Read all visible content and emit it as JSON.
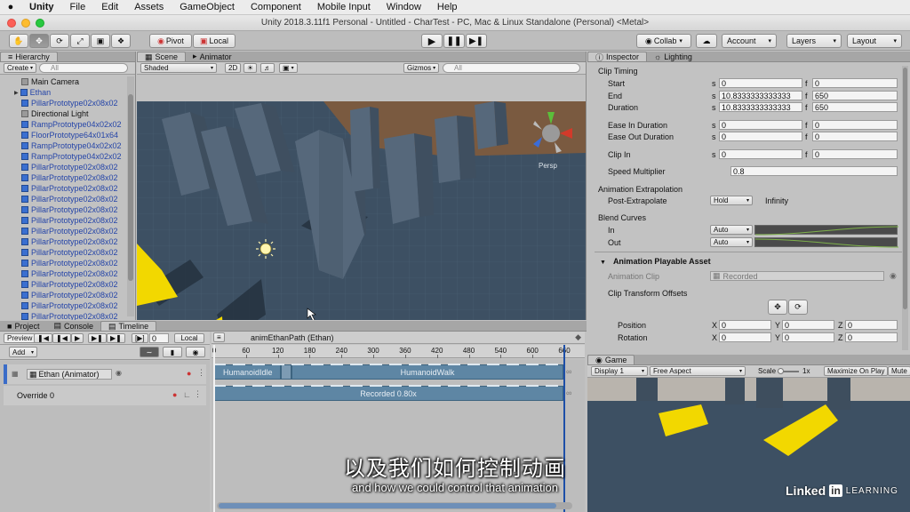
{
  "menubar": {
    "apple": "",
    "items": [
      "Unity",
      "File",
      "Edit",
      "Assets",
      "GameObject",
      "Component",
      "Mobile Input",
      "Window",
      "Help"
    ]
  },
  "window_title": "Unity 2018.3.11f1 Personal - Untitled - CharTest - PC, Mac & Linux Standalone (Personal) <Metal>",
  "toolbar": {
    "pivot": "Pivot",
    "local": "Local",
    "collab": "Collab",
    "account": "Account",
    "layers": "Layers",
    "layout": "Layout"
  },
  "hierarchy": {
    "tab": "Hierarchy",
    "create": "Create",
    "search_placeholder": "All",
    "items": [
      {
        "name": "Main Camera",
        "blue": false
      },
      {
        "name": "Ethan",
        "blue": true
      },
      {
        "name": "PillarPrototype02x08x02",
        "blue": true
      },
      {
        "name": "Directional Light",
        "blue": false
      },
      {
        "name": "RampPrototype04x02x02",
        "blue": true
      },
      {
        "name": "FloorPrototype64x01x64",
        "blue": true
      },
      {
        "name": "RampPrototype04x02x02",
        "blue": true
      },
      {
        "name": "RampPrototype04x02x02",
        "blue": true
      },
      {
        "name": "PillarPrototype02x08x02",
        "blue": true
      },
      {
        "name": "PillarPrototype02x08x02",
        "blue": true
      },
      {
        "name": "PillarPrototype02x08x02",
        "blue": true
      },
      {
        "name": "PillarPrototype02x08x02",
        "blue": true
      },
      {
        "name": "PillarPrototype02x08x02",
        "blue": true
      },
      {
        "name": "PillarPrototype02x08x02",
        "blue": true
      },
      {
        "name": "PillarPrototype02x08x02",
        "blue": true
      },
      {
        "name": "PillarPrototype02x08x02",
        "blue": true
      },
      {
        "name": "PillarPrototype02x08x02",
        "blue": true
      },
      {
        "name": "PillarPrototype02x08x02",
        "blue": true
      },
      {
        "name": "PillarPrototype02x08x02",
        "blue": true
      },
      {
        "name": "PillarPrototype02x08x02",
        "blue": true
      },
      {
        "name": "PillarPrototype02x08x02",
        "blue": true
      },
      {
        "name": "PillarPrototype02x08x02",
        "blue": true
      },
      {
        "name": "PillarPrototype02x08x02",
        "blue": true
      },
      {
        "name": "PillarPrototype02x08x02",
        "blue": true
      }
    ]
  },
  "scene": {
    "tabs": [
      "Scene",
      "Animator"
    ],
    "shading": "Shaded",
    "mode_2d": "2D",
    "gizmos": "Gizmos",
    "search_placeholder": "All",
    "persp": "Persp"
  },
  "inspector": {
    "tabs": [
      "Inspector",
      "Lighting"
    ],
    "clip_timing": "Clip Timing",
    "start_label": "Start",
    "start_s": "0",
    "start_f": "0",
    "end_label": "End",
    "end_s": "10.8333333333333",
    "end_f": "650",
    "duration_label": "Duration",
    "duration_s": "10.8333333333333",
    "duration_f": "650",
    "ease_in_label": "Ease In Duration",
    "ease_in_s": "0",
    "ease_in_f": "0",
    "ease_out_label": "Ease Out Duration",
    "ease_out_s": "0",
    "ease_out_f": "0",
    "clip_in_label": "Clip In",
    "clip_in_s": "0",
    "clip_in_f": "0",
    "s": "s",
    "f": "f",
    "speed_label": "Speed Multiplier",
    "speed_value": "0.8",
    "extrapolation_header": "Animation Extrapolation",
    "post_label": "Post-Extrapolate",
    "post_value": "Hold",
    "post_infinity": "Infinity",
    "blend_header": "Blend Curves",
    "in_label": "In",
    "in_value": "Auto",
    "out_label": "Out",
    "out_value": "Auto",
    "playable_header": "Animation Playable Asset",
    "anim_clip_label": "Animation Clip",
    "anim_clip_value": "Recorded",
    "offsets_label": "Clip Transform Offsets",
    "position_label": "Position",
    "rotation_label": "Rotation",
    "x": "X",
    "y": "Y",
    "z": "Z",
    "pos_x": "0",
    "pos_y": "0",
    "pos_z": "0",
    "rot_x": "0",
    "rot_y": "0",
    "rot_z": "0"
  },
  "bottom_tabs": [
    "Project",
    "Console",
    "Timeline"
  ],
  "timeline": {
    "preview": "Preview",
    "frame": "0",
    "local": "Local",
    "add": "Add",
    "asset_name": "animEthanPath (Ethan)",
    "ruler": [
      "0",
      "60",
      "120",
      "180",
      "240",
      "300",
      "360",
      "420",
      "480",
      "540",
      "600",
      "660"
    ],
    "track1_binding": "Ethan (Animator)",
    "track2_label": "Override 0",
    "clip_idle": "HumanoidIdle",
    "clip_walk": "HumanoidWalk",
    "clip_recorded": "Recorded 0.80x"
  },
  "game": {
    "tab": "Game",
    "display": "Display 1",
    "aspect": "Free Aspect",
    "scale_label": "Scale",
    "scale_value": "1x",
    "maximize": "Maximize On Play",
    "mute": "Mute"
  },
  "subtitles": {
    "cn": "以及我们如何控制动画",
    "en": "and how we could control that animation"
  },
  "watermark": {
    "linked": "Linked",
    "in": "in",
    "learning": "LEARNING"
  }
}
